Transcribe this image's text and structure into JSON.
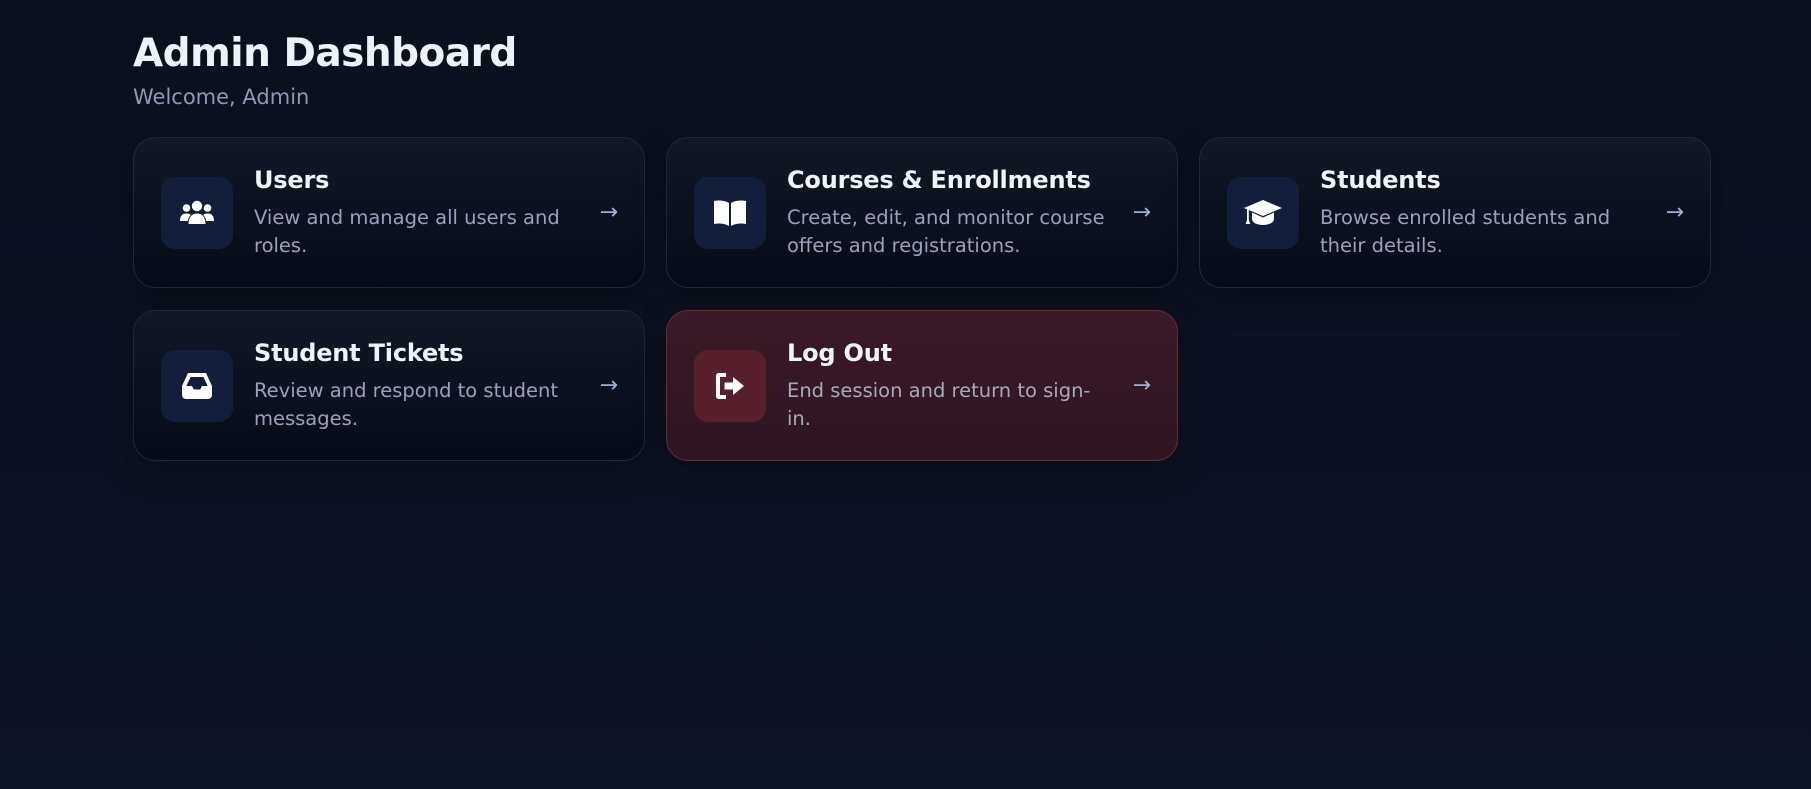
{
  "header": {
    "title": "Admin Dashboard",
    "welcome": "Welcome, Admin"
  },
  "cards": [
    {
      "title": "Users",
      "description": "View and manage all users and roles.",
      "icon": "users-icon",
      "arrow": "→"
    },
    {
      "title": "Courses & Enrollments",
      "description": "Create, edit, and monitor course offers and registrations.",
      "icon": "book-open-icon",
      "arrow": "→"
    },
    {
      "title": "Students",
      "description": "Browse enrolled students and their details.",
      "icon": "graduation-cap-icon",
      "arrow": "→"
    },
    {
      "title": "Student Tickets",
      "description": "Review and respond to student messages.",
      "icon": "inbox-icon",
      "arrow": "→"
    },
    {
      "title": "Log Out",
      "description": "End session and return to sign-in.",
      "icon": "sign-out-icon",
      "arrow": "→"
    }
  ],
  "colors": {
    "background": "#0b1020",
    "card": "#0d1322",
    "icon_tile": "#131e3c",
    "danger_card": "#341823",
    "danger_border": "#6b2a36",
    "danger_icon_tile": "#57202c",
    "arrow": "#9db0d8"
  }
}
